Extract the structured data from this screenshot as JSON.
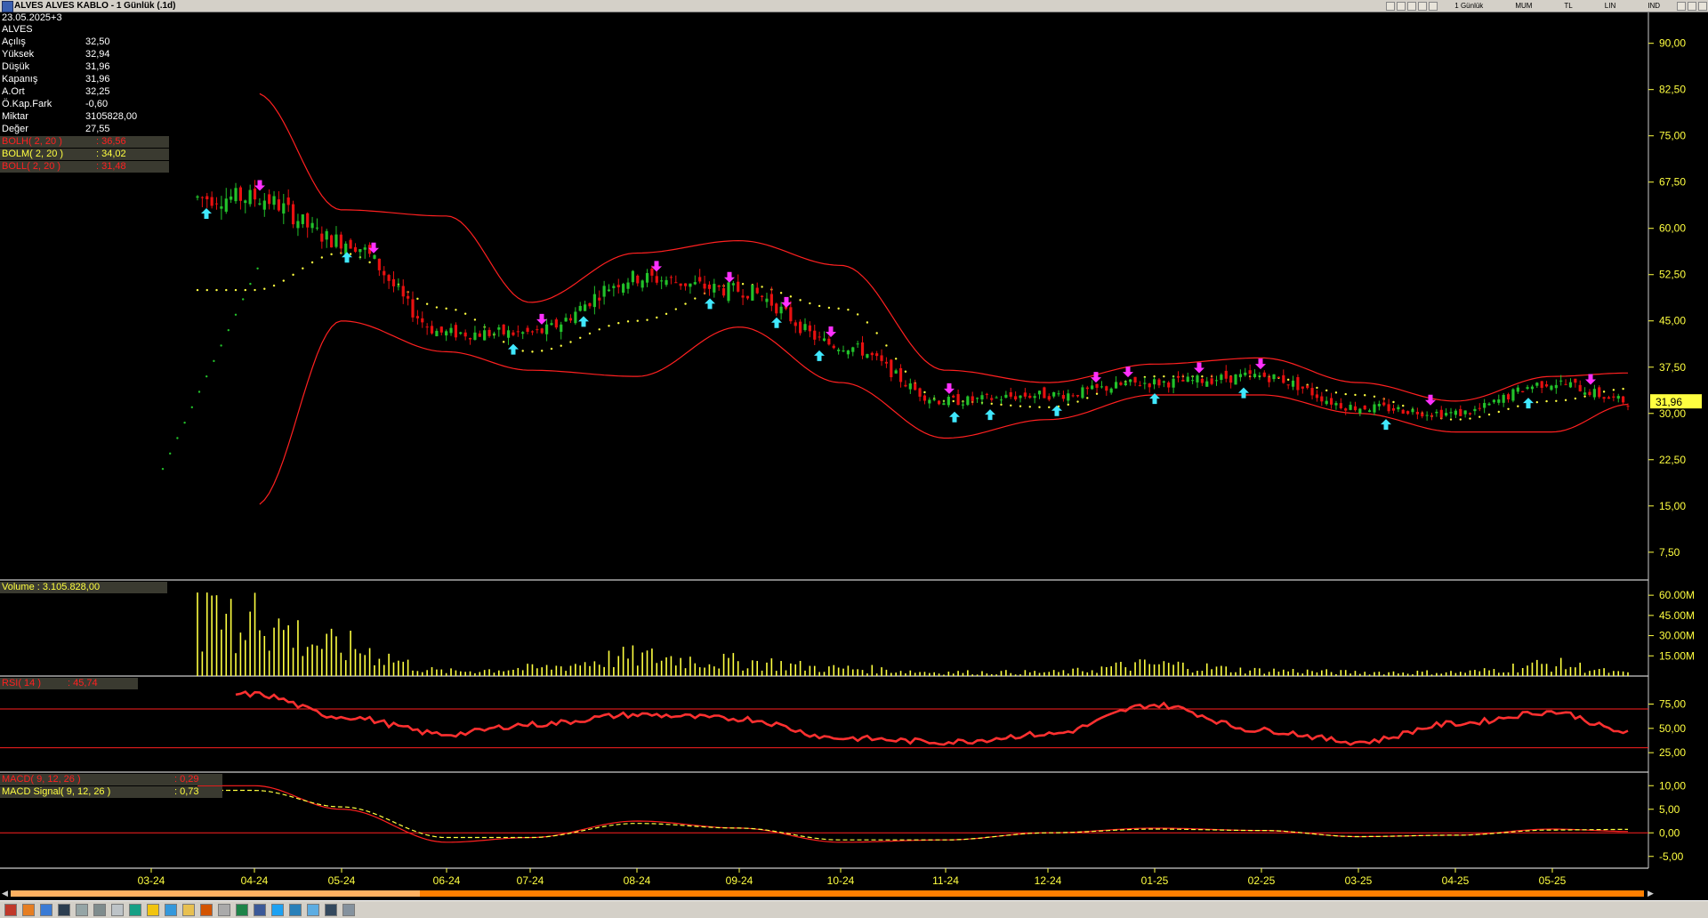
{
  "window": {
    "title": "ALVES ALVES KABLO - 1 Günlük (.1d)",
    "toolbar_labels": [
      "1 Günlük",
      "MUM",
      "TL",
      "LIN",
      "IND"
    ]
  },
  "info": {
    "date": "23.05.2025+3",
    "symbol": "ALVES",
    "rows": [
      {
        "label": "Açılış",
        "value": "32,50"
      },
      {
        "label": "Yüksek",
        "value": "32,94"
      },
      {
        "label": "Düşük",
        "value": "31,96"
      },
      {
        "label": "Kapanış",
        "value": "31,96"
      },
      {
        "label": "A.Ort",
        "value": "32,25"
      },
      {
        "label": "Ö.Kap.Fark",
        "value": "-0,60"
      },
      {
        "label": "Miktar",
        "value": "3105828,00"
      },
      {
        "label": "Değer",
        "value": "27,55"
      }
    ],
    "bollinger": [
      {
        "label": "BOLH( 2, 20 )",
        "value": ": 36,56",
        "color": "#ff2020"
      },
      {
        "label": "BOLM( 2, 20 )",
        "value": ": 34,02",
        "color": "#ffff40"
      },
      {
        "label": "BOLL( 2, 20 )",
        "value": ": 31,48",
        "color": "#ff2020"
      }
    ]
  },
  "panels": {
    "price": {
      "last_value": "31,96",
      "y_ticks": [
        "90,00",
        "82,50",
        "75,00",
        "67,50",
        "60,00",
        "52,50",
        "45,00",
        "37,50",
        "30,00",
        "22,50",
        "15,00",
        "7,50"
      ]
    },
    "volume": {
      "label": "Volume : 3.105.828,00",
      "y_ticks": [
        "60.00M",
        "45.00M",
        "30.00M",
        "15.00M"
      ]
    },
    "rsi": {
      "label": "RSI( 14 )",
      "value": ": 45,74",
      "y_ticks": [
        "75,00",
        "50,00",
        "25,00"
      ]
    },
    "macd": {
      "label": "MACD( 9, 12, 26 )",
      "value": ": 0,29",
      "signal_label": "MACD Signal( 9, 12, 26 )",
      "signal_value": ": 0,73",
      "y_ticks": [
        "10,00",
        "5,00",
        "0,00",
        "-5,00"
      ]
    }
  },
  "x_labels": [
    "03-24",
    "04-24",
    "05-24",
    "06-24",
    "07-24",
    "08-24",
    "09-24",
    "10-24",
    "11-24",
    "12-24",
    "01-25",
    "02-25",
    "03-25",
    "04-25",
    "05-25"
  ],
  "chart_data": {
    "type": "line",
    "x": [
      "03-24",
      "04-24",
      "05-24",
      "06-24",
      "07-24",
      "08-24",
      "09-24",
      "10-24",
      "11-24",
      "12-24",
      "01-25",
      "02-25",
      "03-25",
      "04-25",
      "05-25",
      "05-25 end"
    ],
    "series": [
      {
        "name": "BOLH( 2, 20 )",
        "values": [
          null,
          82,
          63,
          62,
          48,
          56,
          58,
          54,
          37,
          35,
          38,
          39,
          35,
          32,
          36,
          36.56
        ]
      },
      {
        "name": "BOLM( 2, 20 )",
        "values": [
          null,
          50,
          56,
          47,
          40,
          45,
          51,
          47,
          32,
          31,
          36,
          36,
          33,
          29,
          32,
          34.02
        ]
      },
      {
        "name": "BOLL( 2, 20 )",
        "values": [
          null,
          15,
          45,
          40,
          37,
          36,
          44,
          35,
          26,
          29,
          33,
          33,
          30,
          27,
          27,
          31.48
        ]
      },
      {
        "name": "Kapanış",
        "values": [
          null,
          65,
          58,
          43,
          43,
          52,
          50,
          41,
          32,
          33,
          35,
          36,
          31,
          30,
          35,
          31.96
        ]
      },
      {
        "name": "RSI( 14 )",
        "values": [
          null,
          85,
          62,
          44,
          54,
          64,
          60,
          40,
          36,
          44,
          74,
          48,
          36,
          55,
          67,
          45.74
        ]
      },
      {
        "name": "MACD( 9, 12, 26 )",
        "values": [
          null,
          10,
          5,
          -2,
          -1,
          2.5,
          1,
          -2,
          -1.5,
          0,
          1,
          0.5,
          -0.8,
          -0.5,
          0.8,
          0.29
        ]
      },
      {
        "name": "MACD Signal( 9, 12, 26 )",
        "values": [
          null,
          9,
          5.5,
          -1,
          -1,
          2,
          1,
          -1.5,
          -1.5,
          0,
          0.8,
          0.5,
          -0.8,
          -0.5,
          0.6,
          0.73
        ]
      },
      {
        "name": "Volume",
        "values": [
          null,
          55,
          30,
          5,
          8,
          20,
          15,
          8,
          4,
          4,
          12,
          6,
          4,
          4,
          12,
          3.1
        ]
      }
    ],
    "ylim": [
      3,
      95
    ],
    "volume_ylim": [
      0,
      70
    ],
    "rsi_ylim": [
      5,
      102
    ],
    "rsi_levels": [
      70,
      30
    ],
    "macd_ylim": [
      -7.5,
      12.5
    ],
    "grid": false,
    "legend": "top-left",
    "colors": {
      "bull": "#22c22a",
      "bear": "#e81010",
      "band": "#ff2020",
      "mid": "#ffff40",
      "buy": "#40e8ff",
      "sell": "#ff30ff",
      "volume": "#ffff40"
    }
  }
}
